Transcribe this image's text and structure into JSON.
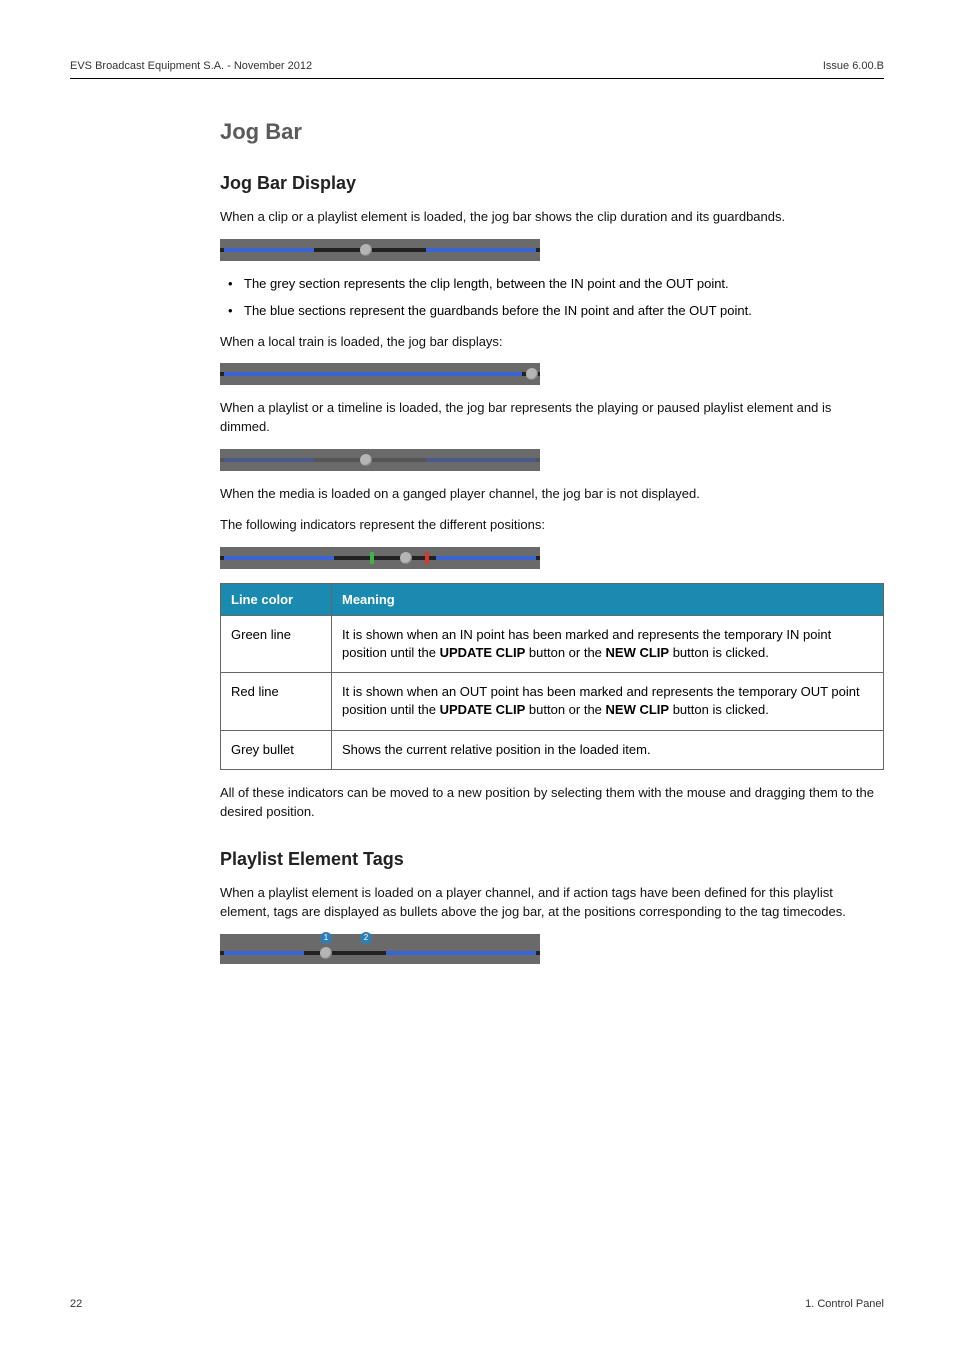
{
  "header": {
    "left": "EVS Broadcast Equipment S.A.  - November 2012",
    "right": "Issue 6.00.B"
  },
  "section": {
    "title": "Jog Bar",
    "sub1": {
      "title": "Jog Bar Display",
      "p1": "When a clip or a playlist element is loaded, the jog bar shows the clip duration and its guardbands.",
      "bullet1": "The grey section represents the clip length, between the IN point and the OUT point.",
      "bullet2": "The blue sections represent the guardbands before the IN point and after the OUT point.",
      "p2": "When a local train is loaded, the jog bar displays:",
      "p3": "When a playlist or a timeline is loaded, the jog bar represents the playing or paused playlist element and is dimmed.",
      "p4": "When the media is loaded on a ganged player channel, the jog bar is not displayed.",
      "p5": "The following indicators represent the different positions:",
      "p6": "All of these indicators can be moved to a new position by selecting them with the mouse and dragging them to the desired position."
    },
    "table": {
      "h1": "Line color",
      "h2": "Meaning",
      "rows": [
        {
          "c1": "Green line",
          "c2_a": "It is shown when an IN point has been marked and represents the temporary IN point position until the ",
          "c2_b": "UPDATE CLIP",
          "c2_c": " button or the ",
          "c2_d": "NEW CLIP",
          "c2_e": " button is clicked."
        },
        {
          "c1": "Red line",
          "c2_a": "It is shown when an OUT point has been marked and represents the temporary OUT point position until the ",
          "c2_b": "UPDATE CLIP",
          "c2_c": " button or the ",
          "c2_d": "NEW CLIP",
          "c2_e": " button is clicked."
        },
        {
          "c1": "Grey bullet",
          "c2_a": "Shows the current relative position in the loaded item.",
          "c2_b": "",
          "c2_c": "",
          "c2_d": "",
          "c2_e": ""
        }
      ]
    },
    "sub2": {
      "title": "Playlist Element Tags",
      "p1": "When a playlist element is loaded on a player channel, and if action tags have been defined for this playlist element, tags are displayed as bullets above the jog bar, at the positions corresponding to the tag timecodes."
    }
  },
  "jogbars": {
    "tag1": "1",
    "tag2": "2"
  },
  "footer": {
    "left": "22",
    "right": "1. Control Panel"
  }
}
